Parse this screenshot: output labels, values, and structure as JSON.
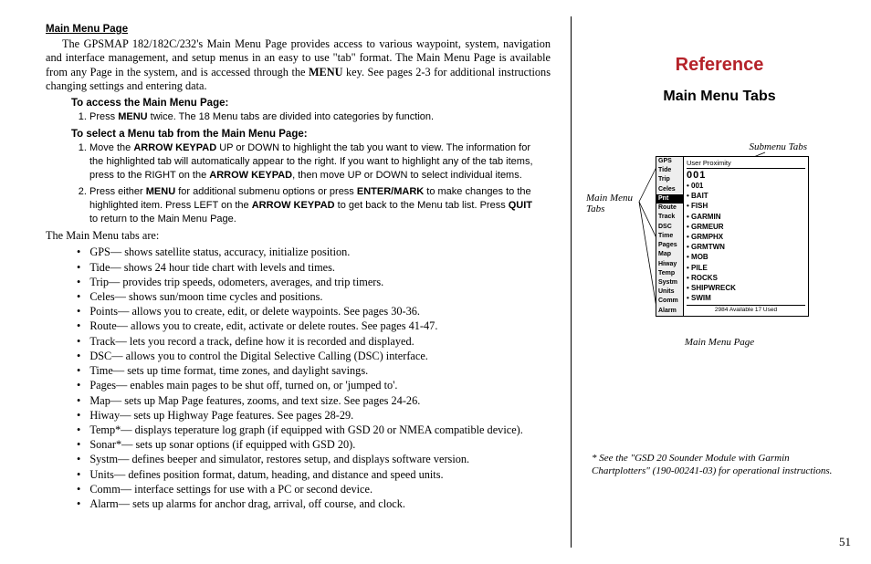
{
  "left": {
    "section_title": "Main Menu Page",
    "intro_html": "The GPSMAP 182/182C/232's Main Menu Page provides access to various waypoint, system, navigation and interface management, and setup menus in an easy to use \"tab\" format. The Main Menu Page is available from any Page in the  system, and is accessed through the <b>MENU</b> key. See pages 2-3 for additional instructions changing settings and entering data.",
    "access_head": "To access the Main Menu Page:",
    "access_step1_html": "Press <b>MENU</b> twice. The 18 Menu tabs are divided into categories by function.",
    "select_head": "To select a Menu tab from the Main Menu Page:",
    "select_step1_html": "Move the <b>ARROW KEYPAD</b> UP or DOWN to highlight the tab you want to view. The information for the highlighted tab will automatically appear to the right. If you want to highlight any of the tab items, press to the RIGHT on the <b>ARROW KEYPAD</b>, then move UP or DOWN to select individual items.",
    "select_step2_html": "Press either <b>MENU</b> for additional submenu options or press <b>ENTER/MARK</b> to make changes to the highlighted item. Press LEFT on the <b>ARROW KEYPAD</b> to get back to the Menu tab list. Press <b>QUIT</b> to return to the Main Menu Page.",
    "tabs_intro": "The Main Menu tabs are:",
    "tabs": [
      "GPS— shows satellite status, accuracy, initialize position.",
      "Tide— shows 24 hour tide chart with levels and times.",
      "Trip— provides trip speeds, odometers, averages, and trip timers.",
      "Celes— shows sun/moon time cycles and positions.",
      "Points— allows you to create, edit, or delete waypoints. See pages 30-36.",
      "Route— allows you to create, edit, activate or delete routes. See pages 41-47.",
      "Track— lets you record a track, define how it is recorded and displayed.",
      "DSC— allows you to control the Digital Selective Calling (DSC) interface.",
      "Time— sets up time format, time zones, and daylight savings.",
      "Pages— enables main pages to be shut off, turned on, or 'jumped to'.",
      "Map— sets up Map Page features, zooms, and text size. See pages 24-26.",
      "Hiway— sets up Highway Page features. See pages 28-29.",
      "Temp*— displays teperature log graph (if equipped with GSD 20 or NMEA compatible device).",
      "Sonar*— sets up sonar options (if equipped with GSD 20).",
      "Systm— defines beeper and simulator, restores setup, and displays software version.",
      "Units— defines position format, datum, heading, and distance and speed units.",
      "Comm— interface settings for use with a PC or second device.",
      "Alarm— sets up alarms for anchor drag, arrival, off course, and clock."
    ]
  },
  "right": {
    "title": "Reference",
    "subtitle": "Main Menu Tabs",
    "submenu_label": "Submenu Tabs",
    "mainmenu_label": "Main Menu Tabs",
    "figure_caption": "Main Menu Page",
    "footnote": "* See the \"GSD 20 Sounder Module with Garmin Chartplotters\" (190-00241-03) for operational instructions.",
    "page_num": "51",
    "screenshot": {
      "header": "User   Proximity",
      "selected_num": "001",
      "tab_col": [
        "GPS",
        "Tide",
        "Trip",
        "Celes",
        "Pnt",
        "Route",
        "Track",
        "DSC",
        "Time",
        "Pages",
        "Map",
        "Hiway",
        "Temp",
        "Systm",
        "Units",
        "Comm",
        "Alarm"
      ],
      "items": [
        "001",
        "BAIT",
        "FISH",
        "GARMIN",
        "GRMEUR",
        "GRMPHX",
        "GRMTWN",
        "MOB",
        "PILE",
        "ROCKS",
        "SHIPWRECK",
        "SWIM"
      ],
      "footer": "2984 Available   17  Used"
    }
  }
}
